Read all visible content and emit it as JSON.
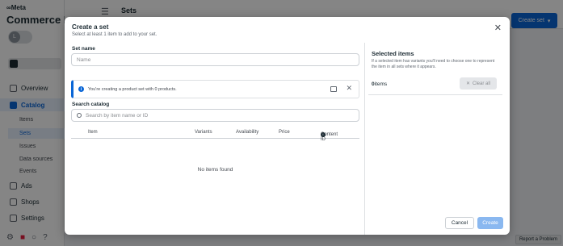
{
  "app": {
    "logo": "∞Meta",
    "title": "Commerce Ma",
    "avatar_initial": "L",
    "page_title": "Sets",
    "create_set_label": "Create set",
    "report_label": "Report a Problem"
  },
  "sidebar": {
    "items": [
      {
        "label": "Overview",
        "icon": "overview-icon"
      },
      {
        "label": "Catalog",
        "icon": "catalog-icon",
        "active": true
      },
      {
        "label": "Ads",
        "icon": "megaphone-icon"
      },
      {
        "label": "Shops",
        "icon": "shop-icon"
      },
      {
        "label": "Settings",
        "icon": "gear-icon"
      }
    ],
    "sub_items": [
      "Items",
      "Sets",
      "Issues",
      "Data sources",
      "Events"
    ]
  },
  "modal": {
    "title": "Create a set",
    "subtitle": "Select at least 1 item to add to your set.",
    "set_name_label": "Set name",
    "set_name_placeholder": "Name",
    "info_text": "You're creating a product set with 0 products.",
    "search_label": "Search catalog",
    "search_placeholder": "Search by item name or ID",
    "columns": [
      "Item",
      "Variants",
      "Availability",
      "Price",
      "Content ID"
    ],
    "empty_text": "No items found",
    "selected_title": "Selected items",
    "selected_desc": "If a selected item has variants you'll need to choose one to represent the item in all sets where it appears.",
    "count_number": "0",
    "count_label": "items",
    "clear_all_label": "Clear all",
    "cancel_label": "Cancel",
    "create_label": "Create"
  },
  "colors": {
    "accent": "#0a66d6",
    "create_disabled": "#8ab8f0"
  }
}
